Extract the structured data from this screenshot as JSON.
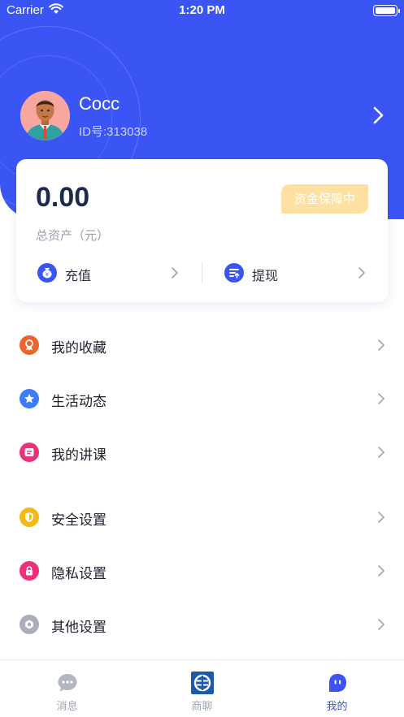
{
  "status_bar": {
    "carrier": "Carrier",
    "time": "1:20 PM"
  },
  "profile": {
    "name": "Cocc",
    "id_text": "ID号:313038"
  },
  "wallet": {
    "balance": "0.00",
    "badge": "资金保障中",
    "assets_label": "总资产（元）",
    "recharge_label": "充值",
    "withdraw_label": "提现"
  },
  "menu": {
    "items": [
      {
        "label": "我的收藏",
        "icon": "ribbon-icon",
        "color": "#f0642c"
      },
      {
        "label": "生活动态",
        "icon": "star-icon",
        "color": "#3e7bf6"
      },
      {
        "label": "我的讲课",
        "icon": "note-icon",
        "color": "#ee2f7c"
      },
      {
        "label": "安全设置",
        "icon": "shield-icon",
        "color": "#f4b916"
      },
      {
        "label": "隐私设置",
        "icon": "lock-icon",
        "color": "#ee2f7c"
      },
      {
        "label": "其他设置",
        "icon": "gear-icon",
        "color": "#a9aebb"
      }
    ]
  },
  "tabbar": {
    "tabs": [
      {
        "label": "消息",
        "icon": "chat-bubble-icon",
        "active": false
      },
      {
        "label": "商聊",
        "icon": "logo-icon",
        "active": false
      },
      {
        "label": "我的",
        "icon": "face-icon",
        "active": true
      }
    ]
  },
  "colors": {
    "primary": "#3b55f5",
    "badge_bg": "#fde0a2",
    "muted_text": "#9aa0ac"
  }
}
